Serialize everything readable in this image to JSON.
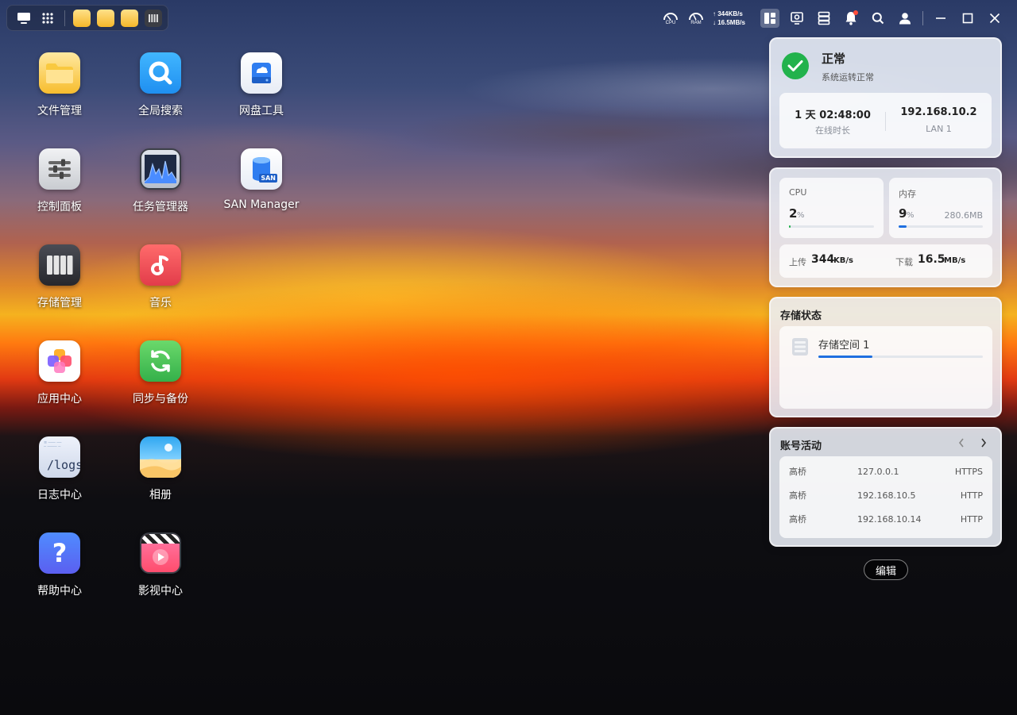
{
  "topbar": {
    "cpu_label": "CPU",
    "ram_label": "RAM",
    "upload_speed": "↑ 344KB/s",
    "download_speed": "↓ 16.5MB/s",
    "icons": [
      "monitor-icon",
      "app-grid-icon",
      "folder-icon",
      "folder-icon",
      "folder-icon",
      "storage-icon",
      "cpu-gauge-icon",
      "ram-gauge-icon",
      "widget-panel-icon",
      "resource-monitor-icon",
      "server-icon",
      "bell-icon",
      "search-icon",
      "user-icon",
      "minimize-icon",
      "maximize-icon",
      "close-icon"
    ]
  },
  "apps": [
    {
      "label": "文件管理",
      "icon": "folder-icon"
    },
    {
      "label": "全局搜索",
      "icon": "search-icon"
    },
    {
      "label": "网盘工具",
      "icon": "cloud-drive-icon"
    },
    {
      "label": "控制面板",
      "icon": "sliders-icon"
    },
    {
      "label": "任务管理器",
      "icon": "chart-icon"
    },
    {
      "label": "SAN Manager",
      "icon": "san-icon"
    },
    {
      "label": "存储管理",
      "icon": "storage-icon"
    },
    {
      "label": "音乐",
      "icon": "music-icon"
    },
    {
      "label": "应用中心",
      "icon": "app-store-icon"
    },
    {
      "label": "同步与备份",
      "icon": "sync-icon"
    },
    {
      "label": "日志中心",
      "icon": "logs-icon"
    },
    {
      "label": "相册",
      "icon": "photos-icon"
    },
    {
      "label": "帮助中心",
      "icon": "help-icon"
    },
    {
      "label": "影视中心",
      "icon": "video-icon"
    }
  ],
  "logs_tile_text": "/logs",
  "san_tile_text": "SAN",
  "status_widget": {
    "status": "正常",
    "status_desc": "系统运转正常",
    "uptime": "1 天 02:48:00",
    "uptime_label": "在线时长",
    "ip": "192.168.10.2",
    "ip_label": "LAN 1",
    "status_color": "#22b24c"
  },
  "resource_widget": {
    "cpu_label": "CPU",
    "cpu_value": "2",
    "cpu_unit": "%",
    "cpu_percent": 2,
    "mem_label": "内存",
    "mem_value": "9",
    "mem_unit": "%",
    "mem_percent": 9,
    "mem_used": "280.6MB",
    "upload_label": "上传",
    "upload_value": "344",
    "upload_unit": "KB/s",
    "download_label": "下载",
    "download_value": "16.5",
    "download_unit": "MB/s",
    "cpu_bar_color": "#22b24c",
    "mem_bar_color": "#1f6fe0"
  },
  "storage_widget": {
    "title": "存储状态",
    "volume_name": "存储空间 1",
    "volume_percent": 33,
    "bar_color": "#1f6fe0"
  },
  "account_widget": {
    "title": "账号活动",
    "rows": [
      {
        "user": "高桥",
        "ip": "127.0.0.1",
        "protocol": "HTTPS"
      },
      {
        "user": "高桥",
        "ip": "192.168.10.5",
        "protocol": "HTTP"
      },
      {
        "user": "高桥",
        "ip": "192.168.10.14",
        "protocol": "HTTP"
      }
    ]
  },
  "edit_label": "编辑"
}
